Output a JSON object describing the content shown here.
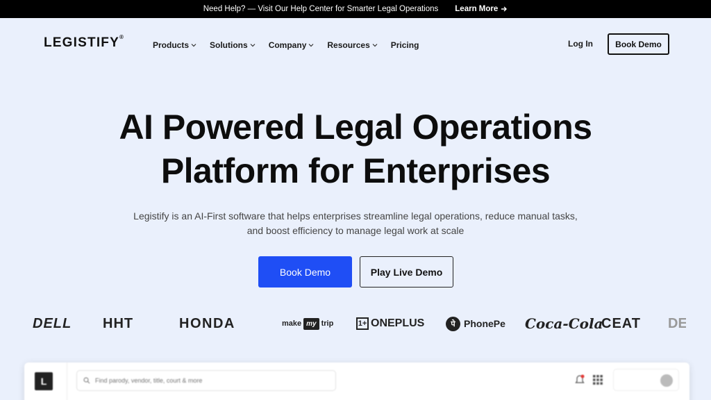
{
  "topbar": {
    "help_text": "Need Help? — Visit Our Help Center for Smarter Legal Operations",
    "learn_more": "Learn More",
    "arrow_icon": "arrow-right-icon"
  },
  "nav": {
    "logo_text": "LEGISTIFY",
    "logo_mark": "®",
    "menu": [
      {
        "label": "Products",
        "icon": "chevron-down-icon"
      },
      {
        "label": "Solutions",
        "icon": "chevron-down-icon"
      },
      {
        "label": "Company",
        "icon": "chevron-down-icon"
      },
      {
        "label": "Resources",
        "icon": "chevron-down-icon"
      },
      {
        "label": "Pricing"
      }
    ],
    "login": "Log In",
    "book_demo": "Book Demo"
  },
  "hero": {
    "title_line1": "AI Powered Legal Operations",
    "title_line2": "Platform for Enterprises",
    "subtitle_line1": "Legistify is an AI-First software that helps enterprises streamline legal operations, reduce manual tasks,",
    "subtitle_line2": "and boost efficiency to manage legal work at scale",
    "primary_cta": "Book Demo",
    "secondary_cta": "Play Live Demo"
  },
  "client_logos": {
    "dell": "DELL",
    "hht": "HHT",
    "honda": "HONDA",
    "makemytrip_make": "make",
    "makemytrip_my": "my",
    "makemytrip_trip": "trip",
    "oneplus_mark": "1+",
    "oneplus": "ONEPLUS",
    "phonepe_mark": "पे",
    "phonepe": "PhonePe",
    "cocacola": "Coca-Cola",
    "ceat": "CEAT",
    "partial": "DE"
  },
  "app_preview": {
    "app_logo": "L",
    "search_placeholder": "Find parody, vendor, title, court & more",
    "icons": [
      "search-icon",
      "bell-icon",
      "grid-icon",
      "avatar"
    ]
  },
  "colors": {
    "background": "#eaf0fc",
    "primary": "#1f4ef5",
    "topbar": "#000000",
    "text": "#111111"
  }
}
